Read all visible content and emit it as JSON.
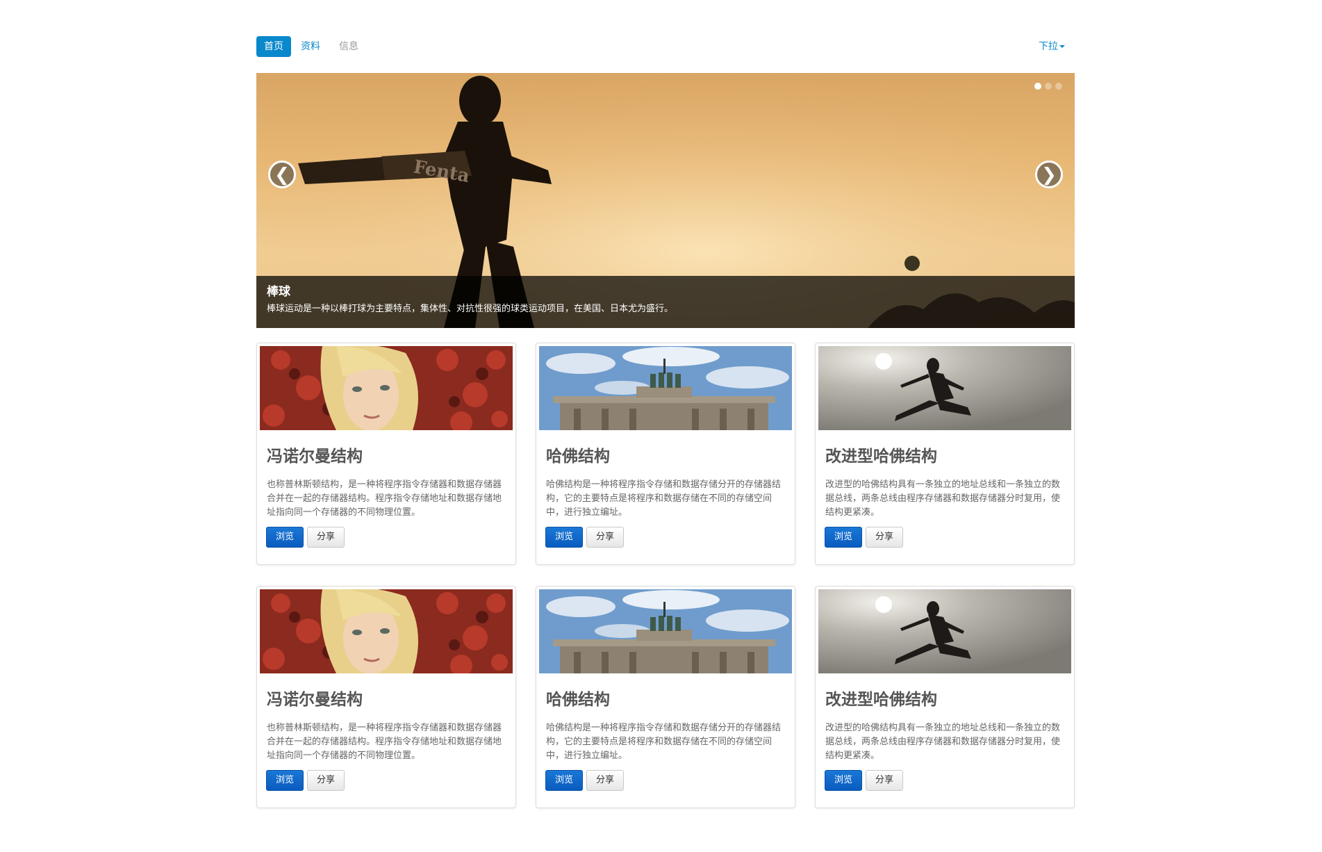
{
  "nav": {
    "pills": [
      {
        "label": "首页",
        "state": "active"
      },
      {
        "label": "资料",
        "state": "link"
      },
      {
        "label": "信息",
        "state": "muted"
      }
    ],
    "dropdown_label": "下拉"
  },
  "carousel": {
    "prev_glyph": "❮",
    "next_glyph": "❯",
    "indicators": [
      true,
      false,
      false
    ],
    "caption_title": "棒球",
    "caption_text": "棒球运动是一种以棒打球为主要特点，集体性、对抗性很强的球类运动项目，在美国、日本尤为盛行。",
    "bat_brand_text": "Fenta"
  },
  "cards": [
    {
      "image": "blonde-woman-photo",
      "title": "冯诺尔曼结构",
      "desc": "也称普林斯顿结构，是一种将程序指令存储器和数据存储器合并在一起的存储器结构。程序指令存储地址和数据存储地址指向同一个存储器的不同物理位置。",
      "primary_label": "浏览",
      "secondary_label": "分享"
    },
    {
      "image": "brandenburg-gate-photo",
      "title": "哈佛结构",
      "desc": "哈佛结构是一种将程序指令存储和数据存储分开的存储器结构，它的主要特点是将程序和数据存储在不同的存储空间中，进行独立编址。",
      "primary_label": "浏览",
      "secondary_label": "分享"
    },
    {
      "image": "martial-arts-kick-photo",
      "title": "改进型哈佛结构",
      "desc": "改进型的哈佛结构具有一条独立的地址总线和一条独立的数据总线，两条总线由程序存储器和数据存储器分时复用，使结构更紧凑。",
      "primary_label": "浏览",
      "secondary_label": "分享"
    },
    {
      "image": "blonde-woman-photo",
      "title": "冯诺尔曼结构",
      "desc": "也称普林斯顿结构，是一种将程序指令存储器和数据存储器合并在一起的存储器结构。程序指令存储地址和数据存储地址指向同一个存储器的不同物理位置。",
      "primary_label": "浏览",
      "secondary_label": "分享"
    },
    {
      "image": "brandenburg-gate-photo",
      "title": "哈佛结构",
      "desc": "哈佛结构是一种将程序指令存储和数据存储分开的存储器结构，它的主要特点是将程序和数据存储在不同的存储空间中，进行独立编址。",
      "primary_label": "浏览",
      "secondary_label": "分享"
    },
    {
      "image": "martial-arts-kick-photo",
      "title": "改进型哈佛结构",
      "desc": "改进型的哈佛结构具有一条独立的地址总线和一条独立的数据总线，两条总线由程序存储器和数据存储器分时复用，使结构更紧凑。",
      "primary_label": "浏览",
      "secondary_label": "分享"
    }
  ],
  "colors": {
    "accent": "#0a88cc",
    "primary_button": "#0a5cbf"
  }
}
